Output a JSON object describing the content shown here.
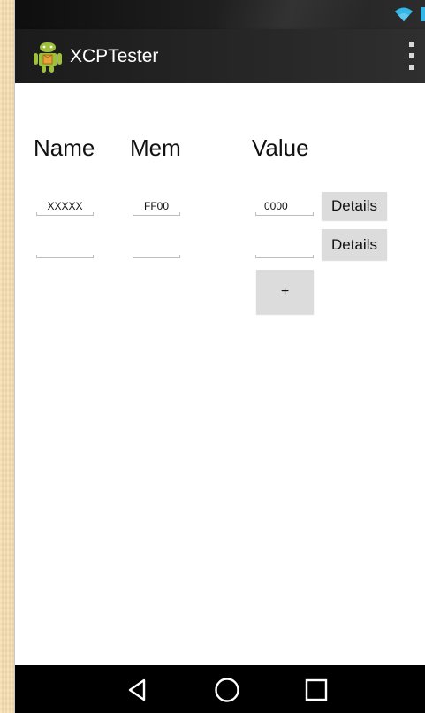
{
  "app": {
    "title": "XCPTester"
  },
  "columns": {
    "name": "Name",
    "mem": "Mem",
    "value": "Value"
  },
  "rows": [
    {
      "name": "XXXXX",
      "mem": "FF00",
      "value": "0000",
      "details_label": "Details"
    },
    {
      "name": "",
      "mem": "",
      "value": "",
      "details_label": "Details"
    }
  ],
  "add_button": {
    "label": "+"
  },
  "icons": {
    "wifi": "wifi-icon",
    "app": "android-icon",
    "overflow": "overflow-menu-icon",
    "back": "back-icon",
    "home": "home-icon",
    "recents": "recents-icon"
  },
  "colors": {
    "status_accent": "#33b5e5",
    "button_bg": "#dcdcdc",
    "action_bar": "#262626"
  }
}
